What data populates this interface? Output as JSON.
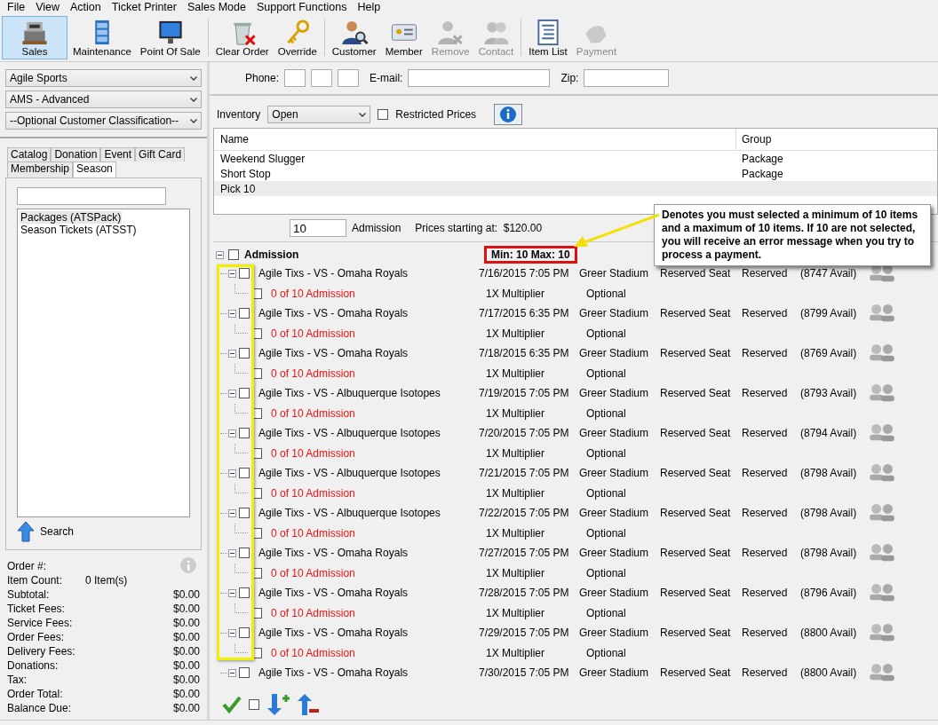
{
  "menu": [
    "File",
    "View",
    "Action",
    "Ticket Printer",
    "Sales Mode",
    "Support Functions",
    "Help"
  ],
  "toolbar": [
    {
      "label": "Sales",
      "selected": true,
      "disabled": false,
      "separator_before": false
    },
    {
      "label": "Maintenance",
      "selected": false,
      "disabled": false,
      "separator_before": false
    },
    {
      "label": "Point Of Sale",
      "selected": false,
      "disabled": false,
      "separator_before": false
    },
    {
      "label": "Clear Order",
      "selected": false,
      "disabled": false,
      "separator_before": true
    },
    {
      "label": "Override",
      "selected": false,
      "disabled": false,
      "separator_before": false
    },
    {
      "label": "Customer",
      "selected": false,
      "disabled": false,
      "separator_before": true
    },
    {
      "label": "Member",
      "selected": false,
      "disabled": false,
      "separator_before": false
    },
    {
      "label": "Remove",
      "selected": false,
      "disabled": true,
      "separator_before": false
    },
    {
      "label": "Contact",
      "selected": false,
      "disabled": true,
      "separator_before": false
    },
    {
      "label": "Item List",
      "selected": false,
      "disabled": false,
      "separator_before": true
    },
    {
      "label": "Payment",
      "selected": false,
      "disabled": true,
      "separator_before": false
    }
  ],
  "sidebar": {
    "dropdowns": [
      "Agile Sports",
      "AMS - Advanced",
      "--Optional Customer Classification--"
    ],
    "tab_rows": [
      [
        {
          "label": "Catalog",
          "selected": false
        },
        {
          "label": "Donation",
          "selected": false
        },
        {
          "label": "Event",
          "selected": false
        },
        {
          "label": "Gift Card",
          "selected": false
        }
      ],
      [
        {
          "label": "Membership",
          "selected": false
        },
        {
          "label": "Season",
          "selected": true
        }
      ]
    ],
    "list_items": [
      {
        "label": "Packages  (ATSPack)",
        "selected": true
      },
      {
        "label": "Season Tickets  (ATSST)",
        "selected": false
      }
    ],
    "search_button": "Search",
    "summary": [
      {
        "label": "Order #:",
        "kind": "info"
      },
      {
        "label": "Item Count:",
        "value": "0 Item(s)",
        "kind": "count"
      },
      {
        "label": "Subtotal:",
        "value": "$0.00",
        "kind": "amount"
      },
      {
        "label": "Ticket Fees:",
        "value": "$0.00",
        "kind": "amount"
      },
      {
        "label": "Service Fees:",
        "value": "$0.00",
        "kind": "amount"
      },
      {
        "label": "Order Fees:",
        "value": "$0.00",
        "kind": "amount"
      },
      {
        "label": "Delivery Fees:",
        "value": "$0.00",
        "kind": "amount"
      },
      {
        "label": "Donations:",
        "value": "$0.00",
        "kind": "amount"
      },
      {
        "label": "Tax:",
        "value": "$0.00",
        "kind": "amount"
      },
      {
        "label": "Order Total:",
        "value": "$0.00",
        "kind": "amount"
      },
      {
        "label": "Balance Due:",
        "value": "$0.00",
        "kind": "amount"
      }
    ]
  },
  "contact": {
    "phone_label": "Phone:",
    "email_label": "E-mail:",
    "zip_label": "Zip:"
  },
  "inventory": {
    "label": "Inventory",
    "value": "Open",
    "restricted_label": "Restricted Prices",
    "restricted_checked": false
  },
  "packages": {
    "columns": [
      "Name",
      "Group"
    ],
    "rows": [
      {
        "name": "Weekend Slugger",
        "group": "Package",
        "selected": false
      },
      {
        "name": "Short Stop",
        "group": "Package",
        "selected": false
      },
      {
        "name": "Pick 10",
        "selected": true
      }
    ]
  },
  "quantity": {
    "value": "10",
    "unit": "Admission",
    "price_label": "Prices starting at:",
    "price": "$120.00"
  },
  "tree": {
    "group": {
      "label": "Admission",
      "checked": false,
      "expanded": true,
      "limit": "Min: 10 Max: 10"
    },
    "events": [
      {
        "name": "Agile Tixs - VS - Omaha Royals",
        "datetime": "7/16/2015 7:05 PM",
        "venue": "Greer Stadium",
        "seat_type": "Reserved Seat",
        "status": "Reserved",
        "availability": "(8747 Avail)",
        "checked": false,
        "expanded": true,
        "children": [
          {
            "label": "0 of 10 Admission",
            "multiplier": "1X Multiplier",
            "requirement": "Optional",
            "checked": false
          }
        ]
      },
      {
        "name": "Agile Tixs - VS - Omaha Royals",
        "datetime": "7/17/2015 6:35 PM",
        "venue": "Greer Stadium",
        "seat_type": "Reserved Seat",
        "status": "Reserved",
        "availability": "(8799 Avail)",
        "checked": false,
        "expanded": true,
        "children": [
          {
            "label": "0 of 10 Admission",
            "multiplier": "1X Multiplier",
            "requirement": "Optional",
            "checked": false
          }
        ]
      },
      {
        "name": "Agile Tixs - VS - Omaha Royals",
        "datetime": "7/18/2015 6:35 PM",
        "venue": "Greer Stadium",
        "seat_type": "Reserved Seat",
        "status": "Reserved",
        "availability": "(8769 Avail)",
        "checked": false,
        "expanded": true,
        "children": [
          {
            "label": "0 of 10 Admission",
            "multiplier": "1X Multiplier",
            "requirement": "Optional",
            "checked": false
          }
        ]
      },
      {
        "name": "Agile Tixs - VS - Albuquerque Isotopes",
        "datetime": "7/19/2015 7:05 PM",
        "venue": "Greer Stadium",
        "seat_type": "Reserved Seat",
        "status": "Reserved",
        "availability": "(8793 Avail)",
        "checked": false,
        "expanded": true,
        "children": [
          {
            "label": "0 of 10 Admission",
            "multiplier": "1X Multiplier",
            "requirement": "Optional",
            "checked": false
          }
        ]
      },
      {
        "name": "Agile Tixs - VS - Albuquerque Isotopes",
        "datetime": "7/20/2015 7:05 PM",
        "venue": "Greer Stadium",
        "seat_type": "Reserved Seat",
        "status": "Reserved",
        "availability": "(8794 Avail)",
        "checked": false,
        "expanded": true,
        "children": [
          {
            "label": "0 of 10 Admission",
            "multiplier": "1X Multiplier",
            "requirement": "Optional",
            "checked": false
          }
        ]
      },
      {
        "name": "Agile Tixs - VS - Albuquerque Isotopes",
        "datetime": "7/21/2015 7:05 PM",
        "venue": "Greer Stadium",
        "seat_type": "Reserved Seat",
        "status": "Reserved",
        "availability": "(8798 Avail)",
        "checked": false,
        "expanded": true,
        "children": [
          {
            "label": "0 of 10 Admission",
            "multiplier": "1X Multiplier",
            "requirement": "Optional",
            "checked": false
          }
        ]
      },
      {
        "name": "Agile Tixs - VS - Albuquerque Isotopes",
        "datetime": "7/22/2015 7:05 PM",
        "venue": "Greer Stadium",
        "seat_type": "Reserved Seat",
        "status": "Reserved",
        "availability": "(8798 Avail)",
        "checked": false,
        "expanded": true,
        "children": [
          {
            "label": "0 of 10 Admission",
            "multiplier": "1X Multiplier",
            "requirement": "Optional",
            "checked": false
          }
        ]
      },
      {
        "name": "Agile Tixs - VS - Omaha Royals",
        "datetime": "7/27/2015 7:05 PM",
        "venue": "Greer Stadium",
        "seat_type": "Reserved Seat",
        "status": "Reserved",
        "availability": "(8798 Avail)",
        "checked": false,
        "expanded": true,
        "children": [
          {
            "label": "0 of 10 Admission",
            "multiplier": "1X Multiplier",
            "requirement": "Optional",
            "checked": false
          }
        ]
      },
      {
        "name": "Agile Tixs - VS - Omaha Royals",
        "datetime": "7/28/2015 7:05 PM",
        "venue": "Greer Stadium",
        "seat_type": "Reserved Seat",
        "status": "Reserved",
        "availability": "(8796 Avail)",
        "checked": false,
        "expanded": true,
        "children": [
          {
            "label": "0 of 10 Admission",
            "multiplier": "1X Multiplier",
            "requirement": "Optional",
            "checked": false
          }
        ]
      },
      {
        "name": "Agile Tixs - VS - Omaha Royals",
        "datetime": "7/29/2015 7:05 PM",
        "venue": "Greer Stadium",
        "seat_type": "Reserved Seat",
        "status": "Reserved",
        "availability": "(8800 Avail)",
        "checked": false,
        "expanded": true,
        "children": [
          {
            "label": "0 of 10 Admission",
            "multiplier": "1X Multiplier",
            "requirement": "Optional",
            "checked": false
          }
        ]
      },
      {
        "name": "Agile Tixs - VS - Omaha Royals",
        "datetime": "7/30/2015 7:05 PM",
        "venue": "Greer Stadium",
        "seat_type": "Reserved Seat",
        "status": "Reserved",
        "availability": "(8800 Avail)",
        "checked": false,
        "expanded": true
      }
    ]
  },
  "callout": "Denotes you must selected a minimum of 10 items and a maximum of 10 items. If 10 are not selected, you will receive an error message when you try to process a payment."
}
